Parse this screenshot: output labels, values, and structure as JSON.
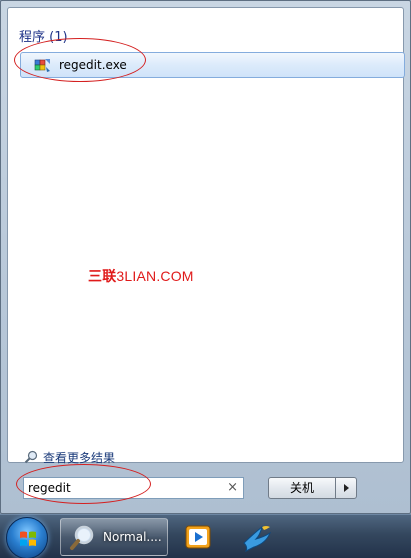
{
  "start_menu": {
    "group_header": "程序 (1)",
    "results": [
      {
        "label": "regedit.exe",
        "icon": "regedit-icon"
      }
    ],
    "more_results_label": "查看更多结果",
    "search": {
      "value": "regedit",
      "clear_glyph": "×"
    },
    "shutdown_label": "关机"
  },
  "watermark": {
    "brand_cn": "三联",
    "brand_en": "3LIAN.COM"
  },
  "taskbar": {
    "active_window_label": "Normal....",
    "icons": [
      "start-orb-icon",
      "search-icon",
      "media-player-icon",
      "bird-app-icon"
    ]
  },
  "colors": {
    "annotation_red": "#d42020",
    "highlight_blue": "#cfe3f9",
    "taskbar_dark": "#22324a"
  }
}
